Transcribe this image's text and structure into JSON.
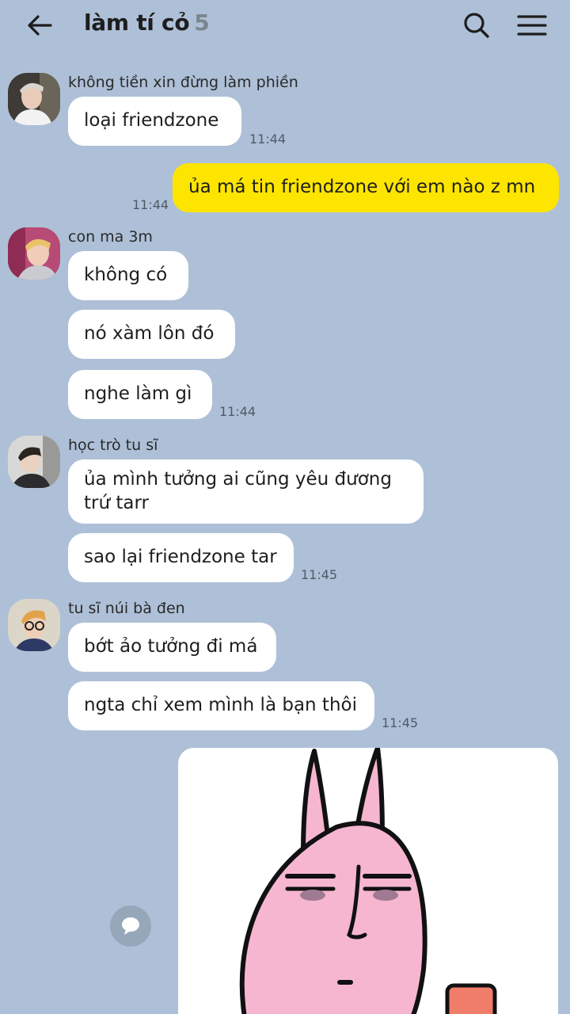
{
  "header": {
    "title": "làm tí cỏ",
    "member_count": "5",
    "icons": {
      "back": "arrow-left-icon",
      "search": "search-icon",
      "menu": "hamburger-menu-icon"
    }
  },
  "messages": [
    {
      "sender": "không tiền xin đừng làm phiền",
      "avatar": "user-avatar-1",
      "texts": [
        "loại friendzone"
      ],
      "time": "11:44"
    },
    {
      "mine": true,
      "texts": [
        "ủa má tin friendzone với em nào z mn"
      ],
      "time": "11:44"
    },
    {
      "sender": "con ma 3m",
      "avatar": "user-avatar-2",
      "texts": [
        "không có",
        "nó xàm lôn đó",
        "nghe làm gì"
      ],
      "time": "11:44"
    },
    {
      "sender": "học trò tu sĩ",
      "avatar": "user-avatar-3",
      "texts": [
        "ủa mình tưởng ai cũng yêu đương trứ tarr",
        "sao lại friendzone tar"
      ],
      "time": "11:45"
    },
    {
      "sender": "tu sĩ núi bà đen",
      "avatar": "user-avatar-4",
      "texts": [
        "bớt ảo tưởng đi má",
        "ngta chỉ xem mình là bạn thôi"
      ],
      "time": "11:45"
    }
  ],
  "sticker": {
    "icon": "pink-rabbit-sticker"
  },
  "colors": {
    "background": "#aec0d7",
    "my_bubble": "#fee500",
    "other_bubble": "#ffffff",
    "sticker_pink": "#f6b6d0"
  }
}
